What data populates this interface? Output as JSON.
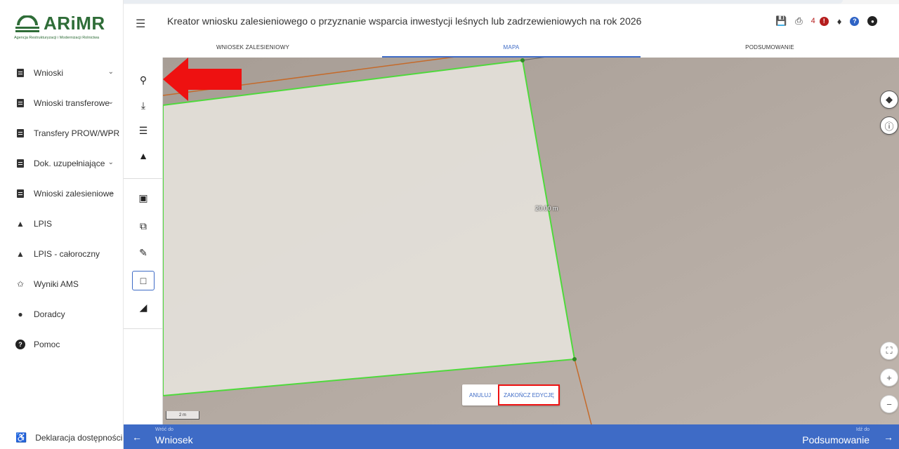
{
  "app": {
    "logo_text": "ARiMR",
    "logo_subtitle": "Agencja Restrukturyzacji i Modernizacji Rolnictwa"
  },
  "sidebar": {
    "items": [
      {
        "label": "Wnioski",
        "icon": "document-icon",
        "has_chevron": true
      },
      {
        "label": "Wnioski transferowe",
        "icon": "document-icon",
        "has_chevron": true
      },
      {
        "label": "Transfery PROW/WPR",
        "icon": "document-icon",
        "has_chevron": true
      },
      {
        "label": "Dok. uzupełniające",
        "icon": "document-icon",
        "has_chevron": true
      },
      {
        "label": "Wnioski zalesieniowe",
        "icon": "document-icon",
        "has_chevron": true
      },
      {
        "label": "LPIS",
        "icon": "terrain-icon",
        "has_chevron": false
      },
      {
        "label": "LPIS - całoroczny",
        "icon": "terrain-icon",
        "has_chevron": false
      },
      {
        "label": "Wyniki AMS",
        "icon": "satellite-icon",
        "has_chevron": false
      },
      {
        "label": "Doradcy",
        "icon": "person-icon",
        "has_chevron": false
      },
      {
        "label": "Pomoc",
        "icon": "help-icon",
        "has_chevron": false
      }
    ],
    "footer_label": "Deklaracja dostępności"
  },
  "header": {
    "title": "Kreator wniosku zalesieniowego o przyznanie wsparcia inwestycji leśnych lub zadrzewieniowych na rok 2026",
    "error_count": "4"
  },
  "tabs": [
    {
      "label": "WNIOSEK ZALESIENIOWY",
      "active": false
    },
    {
      "label": "MAPA",
      "active": true
    },
    {
      "label": "PODSUMOWANIE",
      "active": false
    }
  ],
  "map": {
    "measurement_label": "20.00 m",
    "scale_label": "2 m",
    "cancel_label": "ANULUJ",
    "finish_label": "ZAKOŃCZ EDYCJĘ"
  },
  "bottom_bar": {
    "back_small": "Wróć do",
    "back_big": "Wniosek",
    "next_small": "Idź do",
    "next_big": "Podsumowanie"
  },
  "colors": {
    "accent": "#3e6bc6",
    "brand": "#2f6d38",
    "error": "#b51d1d",
    "polygon_edge": "#4fd93c",
    "highlight": "#ee1111"
  }
}
